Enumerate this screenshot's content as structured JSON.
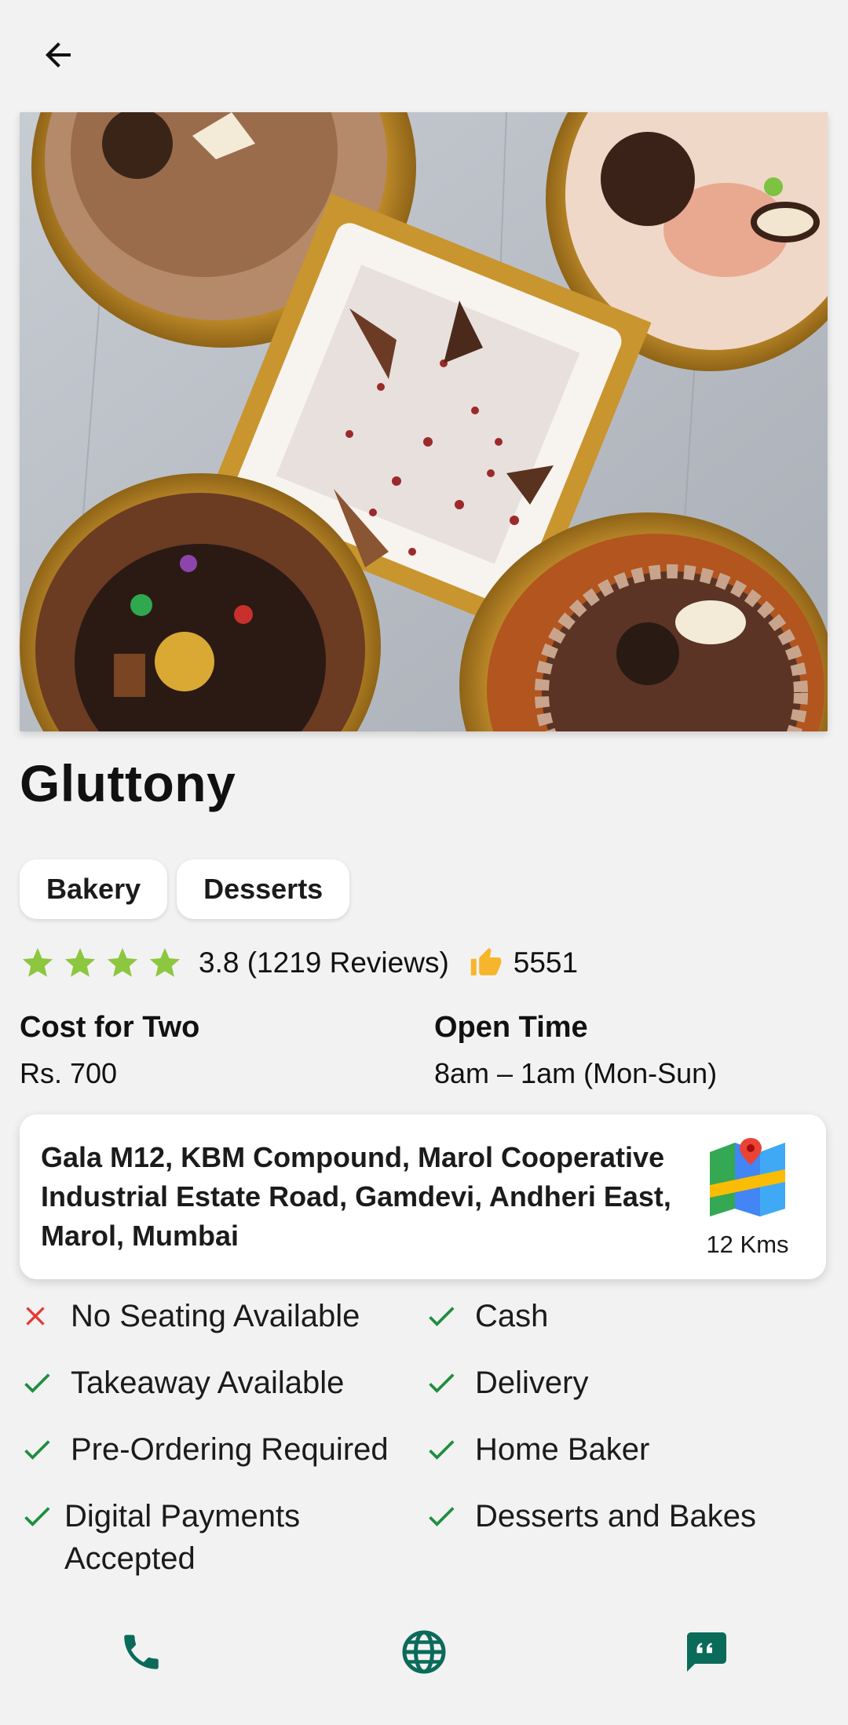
{
  "business": {
    "name": "Gluttony",
    "categories": [
      "Bakery",
      "Desserts"
    ],
    "rating": "3.8 (1219 Reviews)",
    "likes": "5551"
  },
  "info": {
    "cost_title": "Cost for Two",
    "cost_value": "Rs. 700",
    "open_title": "Open Time",
    "open_value": "8am – 1am (Mon-Sun)"
  },
  "address": {
    "text": "Gala M12, KBM Compound, Marol Cooperative Industrial Estate Road, Gamdevi, Andheri East, Marol, Mumbai",
    "distance": "12 Kms"
  },
  "features": [
    {
      "label": "No Seating Available",
      "available": false
    },
    {
      "label": "Cash",
      "available": true
    },
    {
      "label": "Takeaway Available",
      "available": true
    },
    {
      "label": "Delivery",
      "available": true
    },
    {
      "label": "Pre-Ordering Required",
      "available": true
    },
    {
      "label": "Home Baker",
      "available": true
    },
    {
      "label": "Digital Payments Accepted",
      "available": true
    },
    {
      "label": "Desserts and Bakes",
      "available": true
    }
  ],
  "icons": {
    "back": "arrow-back-icon",
    "star": "star-icon",
    "like": "thumbs-up-icon",
    "map": "map-icon",
    "check": "check-icon",
    "cross": "close-icon",
    "phone": "phone-icon",
    "web": "globe-icon",
    "review": "review-icon"
  },
  "colors": {
    "star": "#8dc63f",
    "like": "#f7b52c",
    "check": "#1e8e3e",
    "cross": "#e53935",
    "accent": "#0b6b5a"
  }
}
